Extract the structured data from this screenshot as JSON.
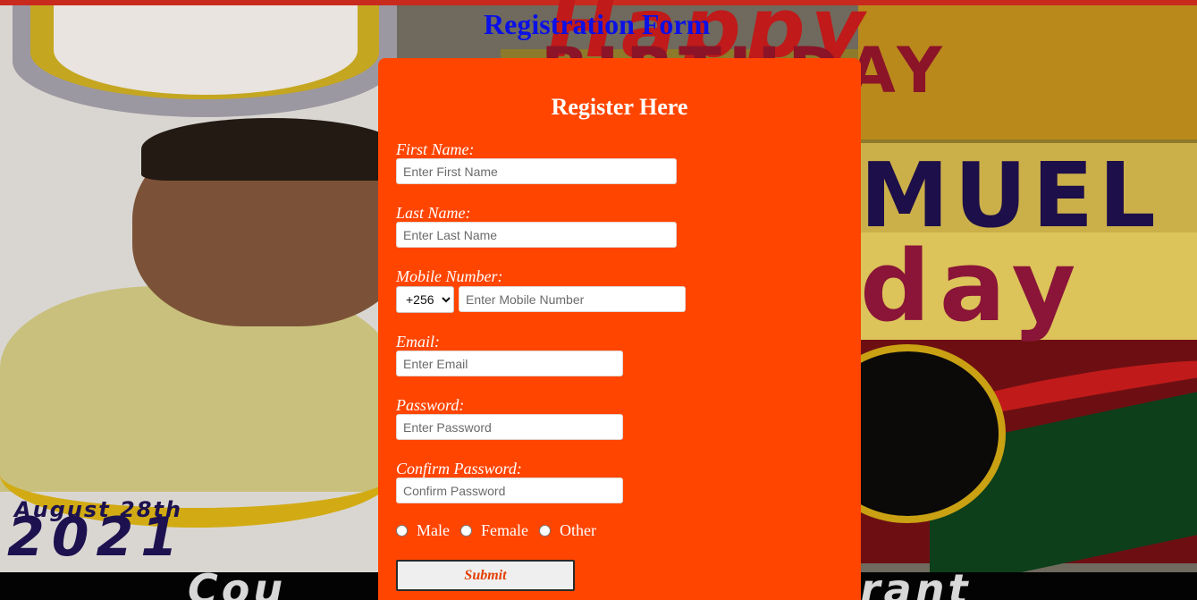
{
  "page_title": "Registration Form",
  "background": {
    "line_1": "Happy",
    "line_2": "BIRTHDAY",
    "line_3": "MUEL",
    "line_4": "day",
    "date_line": "August 28th",
    "year_line": "2021",
    "bottom_left": "Cou",
    "bottom_right": "rant"
  },
  "form": {
    "heading": "Register Here",
    "first_name": {
      "label": "First Name:",
      "placeholder": "Enter First Name"
    },
    "last_name": {
      "label": "Last Name:",
      "placeholder": "Enter Last Name"
    },
    "mobile": {
      "label": "Mobile Number:",
      "country_code": "+256",
      "placeholder": "Enter Mobile Number"
    },
    "email": {
      "label": "Email:",
      "placeholder": "Enter Email"
    },
    "password": {
      "label": "Password:",
      "placeholder": "Enter Password"
    },
    "confirm_password": {
      "label": "Confirm Password:",
      "placeholder": "Confirm Password"
    },
    "gender_options": [
      "Male",
      "Female",
      "Other"
    ],
    "submit_label": "Submit"
  },
  "colors": {
    "card_background": "#ff4500",
    "page_title": "#0b10e6",
    "submit_text": "#e33d00"
  }
}
